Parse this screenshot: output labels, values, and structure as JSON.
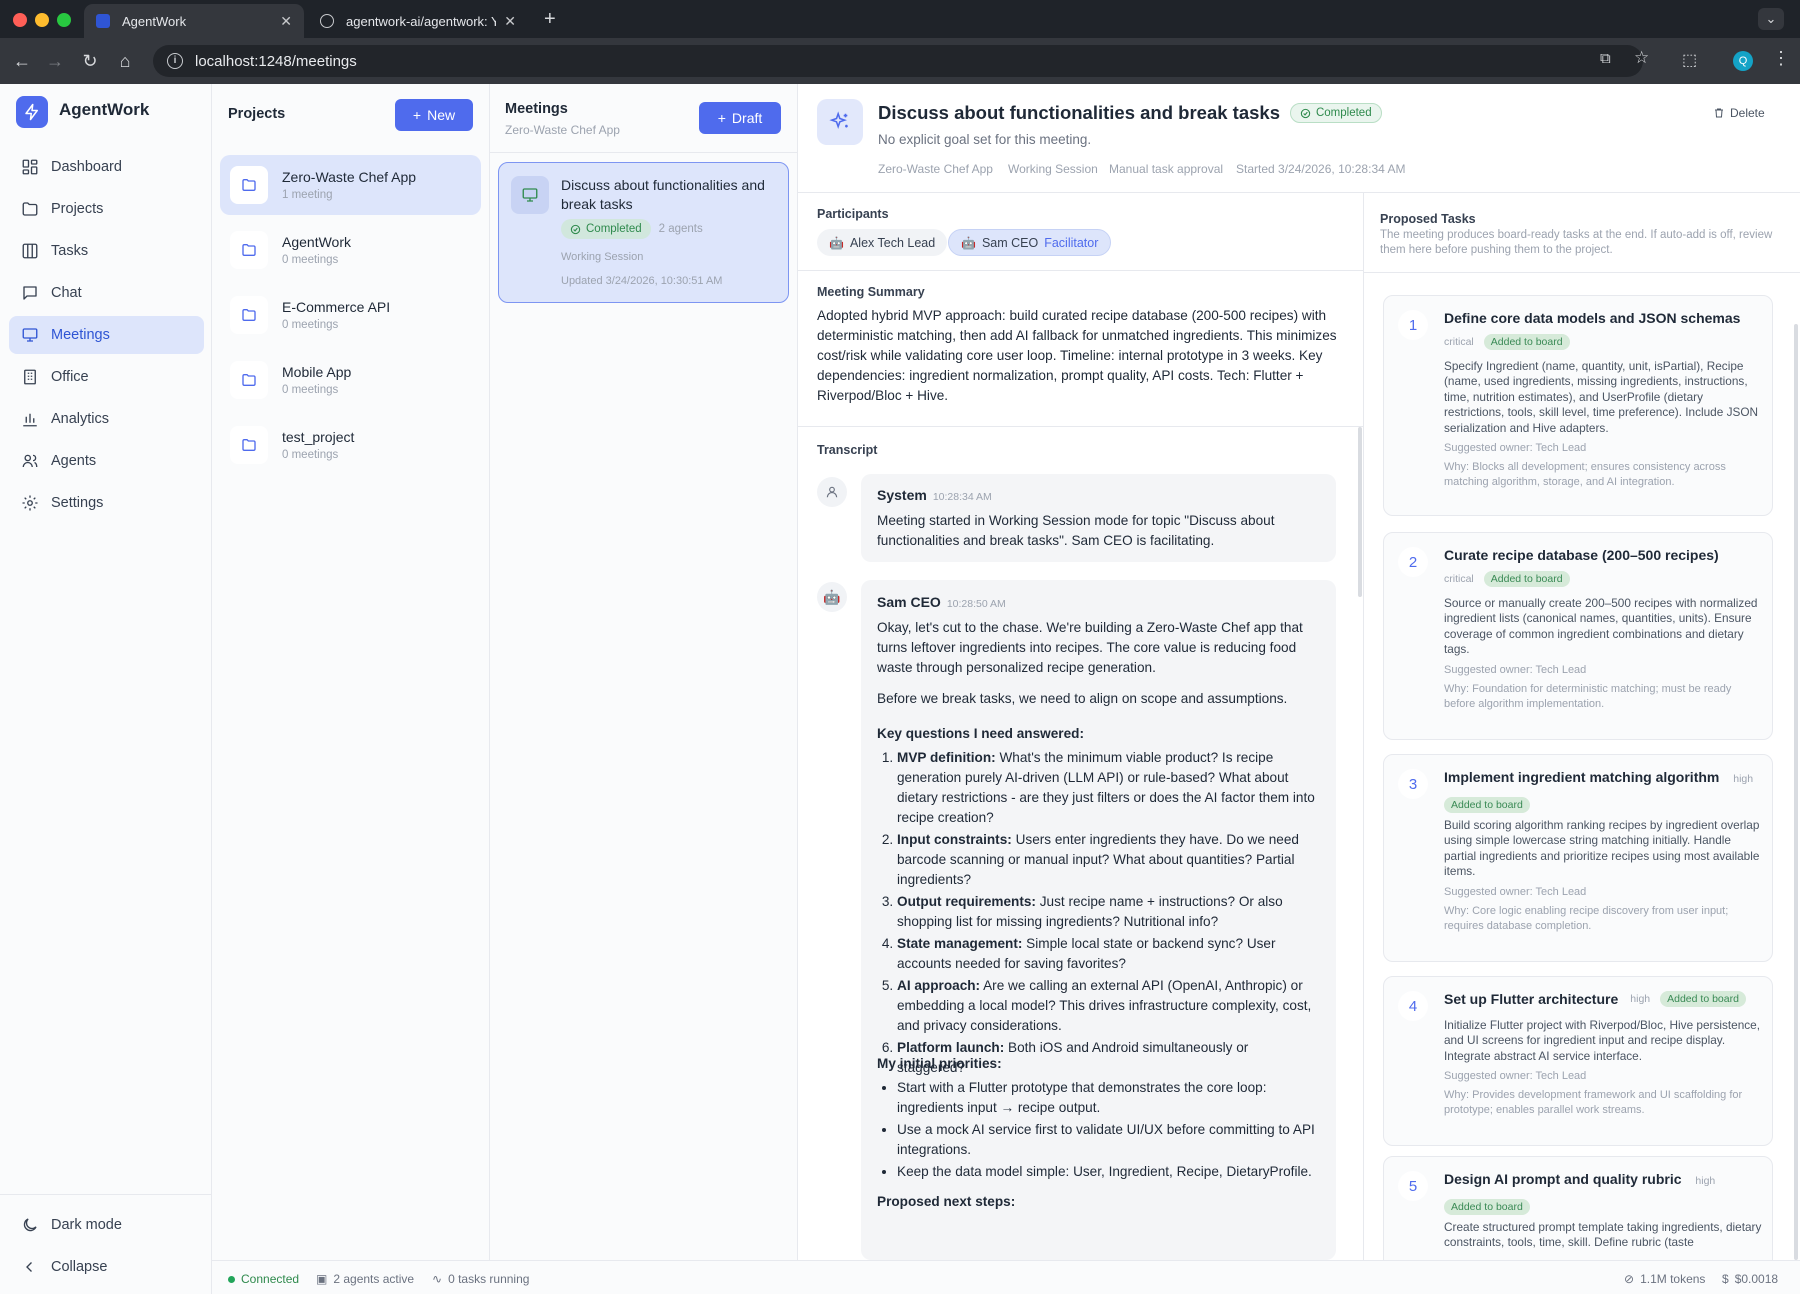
{
  "browser": {
    "tabs": [
      {
        "title": "AgentWork",
        "active": true
      },
      {
        "title": "agentwork-ai/agentwork: You",
        "active": false
      }
    ],
    "url": "localhost:1248/meetings",
    "profile_initial": "Q"
  },
  "sidebar": {
    "app_name": "AgentWork",
    "items": [
      {
        "label": "Dashboard",
        "icon": "dashboard-icon"
      },
      {
        "label": "Projects",
        "icon": "folder-icon"
      },
      {
        "label": "Tasks",
        "icon": "kanban-icon"
      },
      {
        "label": "Chat",
        "icon": "chat-icon"
      },
      {
        "label": "Meetings",
        "icon": "presentation-icon",
        "active": true
      },
      {
        "label": "Office",
        "icon": "building-icon"
      },
      {
        "label": "Analytics",
        "icon": "bar-chart-icon"
      },
      {
        "label": "Agents",
        "icon": "users-icon"
      },
      {
        "label": "Settings",
        "icon": "gear-icon"
      }
    ],
    "dark_mode_label": "Dark mode",
    "collapse_label": "Collapse"
  },
  "projects": {
    "title": "Projects",
    "new_label": "New",
    "items": [
      {
        "name": "Zero-Waste Chef App",
        "count": "1 meeting",
        "active": true
      },
      {
        "name": "AgentWork",
        "count": "0 meetings"
      },
      {
        "name": "E-Commerce API",
        "count": "0 meetings"
      },
      {
        "name": "Mobile App",
        "count": "0 meetings"
      },
      {
        "name": "test_project",
        "count": "0 meetings"
      }
    ]
  },
  "meetings": {
    "title": "Meetings",
    "subtitle": "Zero-Waste Chef App",
    "draft_label": "Draft",
    "card": {
      "title_line1": "Discuss about functionalities and",
      "title_line2": "break tasks",
      "status": "Completed",
      "agents": "2 agents",
      "mode": "Working Session",
      "updated": "Updated 3/24/2026, 10:30:51 AM"
    }
  },
  "detail": {
    "title": "Discuss about functionalities and break tasks",
    "status": "Completed",
    "goal": "No explicit goal set for this meeting.",
    "delete_label": "Delete",
    "meta": [
      "Zero-Waste Chef App",
      "Working Session",
      "Manual task approval",
      "Started 3/24/2026, 10:28:34 AM"
    ],
    "participants_label": "Participants",
    "participants": [
      {
        "name": "Alex Tech Lead",
        "role": ""
      },
      {
        "name": "Sam CEO",
        "role": "Facilitator"
      }
    ],
    "summary_label": "Meeting Summary",
    "summary": "Adopted hybrid MVP approach: build curated recipe database (200-500 recipes) with deterministic matching, then add AI fallback for unmatched ingredients. This minimizes cost/risk while validating core user loop. Timeline: internal prototype in 3 weeks. Key dependencies: ingredient normalization, prompt quality, API costs. Tech: Flutter + Riverpod/Bloc + Hive.",
    "transcript_label": "Transcript",
    "messages": [
      {
        "author": "System",
        "time": "10:28:34 AM",
        "text": "Meeting started in Working Session mode for topic \"Discuss about functionalities and break tasks\". Sam CEO is facilitating."
      },
      {
        "author": "Sam CEO",
        "time": "10:28:50 AM",
        "p1": "Okay, let's cut to the chase. We're building a Zero-Waste Chef app that turns leftover ingredients into recipes. The core value is reducing food waste through personalized recipe generation.",
        "p2": "Before we break tasks, we need to align on scope and assumptions.",
        "questions_heading": "Key questions I need answered:",
        "questions": [
          {
            "k": "MVP definition:",
            "v": " What's the minimum viable product? Is recipe generation purely AI-driven (LLM API) or rule-based? What about dietary restrictions - are they just filters or does the AI factor them into recipe creation?"
          },
          {
            "k": "Input constraints:",
            "v": " Users enter ingredients they have. Do we need barcode scanning or manual input? What about quantities? Partial ingredients?"
          },
          {
            "k": "Output requirements:",
            "v": " Just recipe name + instructions? Or also shopping list for missing ingredients? Nutritional info?"
          },
          {
            "k": "State management:",
            "v": " Simple local state or backend sync? User accounts needed for saving favorites?"
          },
          {
            "k": "AI approach:",
            "v": " Are we calling an external API (OpenAI, Anthropic) or embedding a local model? This drives infrastructure complexity, cost, and privacy considerations."
          },
          {
            "k": "Platform launch:",
            "v": " Both iOS and Android simultaneously or staggered?"
          }
        ],
        "priorities_heading": "My initial priorities:",
        "priorities": [
          "Start with a Flutter prototype that demonstrates the core loop: ingredients input → recipe output.",
          "Use a mock AI service first to validate UI/UX before committing to API integrations.",
          "Keep the data model simple: User, Ingredient, Recipe, DietaryProfile."
        ],
        "cutoff": "Proposed next steps:"
      }
    ],
    "proposed_label": "Proposed Tasks",
    "proposed_desc": "The meeting produces board-ready tasks at the end. If auto-add is off, review them here before pushing them to the project.",
    "tasks": [
      {
        "n": "1",
        "title": "Define core data models and JSON schemas",
        "priority": "critical",
        "added": "Added to board",
        "desc": "Specify Ingredient (name, quantity, unit, isPartial), Recipe (name, used ingredients, missing ingredients, instructions, time, nutrition estimates), and UserProfile (dietary restrictions, tools, skill level, time preference). Include JSON serialization and Hive adapters.",
        "owner": "Suggested owner: Tech Lead",
        "why": "Why: Blocks all development; ensures consistency across matching algorithm, storage, and AI integration."
      },
      {
        "n": "2",
        "title": "Curate recipe database (200–500 recipes)",
        "priority": "critical",
        "added": "Added to board",
        "desc": "Source or manually create 200–500 recipes with normalized ingredient lists (canonical names, quantities, units). Ensure coverage of common ingredient combinations and dietary tags.",
        "owner": "Suggested owner: Tech Lead",
        "why": "Why: Foundation for deterministic matching; must be ready before algorithm implementation."
      },
      {
        "n": "3",
        "title": "Implement ingredient matching algorithm",
        "priority": "high",
        "added": "Added to board",
        "desc": "Build scoring algorithm ranking recipes by ingredient overlap using simple lowercase string matching initially. Handle partial ingredients and prioritize recipes using most available items.",
        "owner": "Suggested owner: Tech Lead",
        "why": "Why: Core logic enabling recipe discovery from user input; requires database completion."
      },
      {
        "n": "4",
        "title": "Set up Flutter architecture",
        "priority": "high",
        "added": "Added to board",
        "desc": "Initialize Flutter project with Riverpod/Bloc, Hive persistence, and UI screens for ingredient input and recipe display. Integrate abstract AI service interface.",
        "owner": "Suggested owner: Tech Lead",
        "why": "Why: Provides development framework and UI scaffolding for prototype; enables parallel work streams."
      },
      {
        "n": "5",
        "title": "Design AI prompt and quality rubric",
        "priority": "high",
        "added": "Added to board",
        "desc": "Create structured prompt template taking ingredients, dietary constraints, tools, time, skill. Define rubric (taste",
        "owner": "",
        "why": ""
      }
    ]
  },
  "status": {
    "connection": "Connected",
    "agents": "2 agents active",
    "tasks": "0 tasks running",
    "tokens": "1.1M tokens",
    "cost": "$0.0018"
  },
  "colors": {
    "accent": "#4f6bed",
    "success": "#2f8a4d",
    "active_bg": "#dde5fb"
  }
}
